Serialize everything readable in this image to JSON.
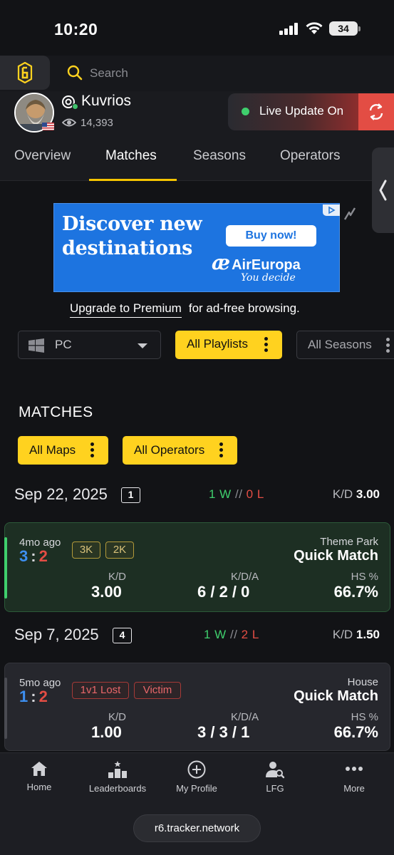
{
  "status_bar": {
    "time": "10:20",
    "battery": "34"
  },
  "header": {
    "search_placeholder": "Search"
  },
  "profile": {
    "username": "Kuvrios",
    "views": "14,393",
    "live_update_label": "Live Update On"
  },
  "tabs": [
    {
      "label": "Overview"
    },
    {
      "label": "Matches"
    },
    {
      "label": "Seasons"
    },
    {
      "label": "Operators"
    }
  ],
  "ad": {
    "headline_line1": "Discover new",
    "headline_line2": "destinations",
    "button": "Buy now!",
    "brand": "AirEuropa",
    "tagline": "You decide"
  },
  "premium": {
    "link": "Upgrade to Premium",
    "text": "for ad-free browsing."
  },
  "filters": {
    "platform": "PC",
    "playlist": "All Playlists",
    "season": "All Seasons"
  },
  "matches": {
    "title": "MATCHES",
    "map_filter": "All Maps",
    "operator_filter": "All Operators",
    "groups": [
      {
        "date": "Sep 22, 2025",
        "count": "1",
        "wins": "1 W",
        "sep": "//",
        "losses": "0 L",
        "kd_label": "K/D",
        "kd": "3.00",
        "matches": [
          {
            "ago": "4mo ago",
            "score_a": "3",
            "score_b": "2",
            "tags": [
              "3K",
              "2K"
            ],
            "map": "Theme Park",
            "mode": "Quick Match",
            "kd_label": "K/D",
            "kd": "3.00",
            "kda_label": "K/D/A",
            "kda": "6 / 2 / 0",
            "hs_label": "HS %",
            "hs": "66.7%",
            "result": "win",
            "accent": "#3fcf6d"
          }
        ]
      },
      {
        "date": "Sep 7, 2025",
        "count": "4",
        "wins": "1 W",
        "sep": "//",
        "losses": "2 L",
        "kd_label": "K/D",
        "kd": "1.50",
        "matches": [
          {
            "ago": "5mo ago",
            "score_a": "1",
            "score_b": "2",
            "tags": [
              "1v1 Lost",
              "Victim"
            ],
            "map": "House",
            "mode": "Quick Match",
            "kd_label": "K/D",
            "kd": "1.00",
            "kda_label": "K/D/A",
            "kda": "3 / 3 / 1",
            "hs_label": "HS %",
            "hs": "66.7%",
            "result": "loss",
            "accent": "#4a4b52"
          }
        ]
      }
    ]
  },
  "bottom_nav": [
    {
      "label": "Home",
      "icon": "home-icon"
    },
    {
      "label": "Leaderboards",
      "icon": "leaderboards-icon"
    },
    {
      "label": "My Profile",
      "icon": "plus-circle-icon"
    },
    {
      "label": "LFG",
      "icon": "lfg-icon"
    },
    {
      "label": "More",
      "icon": "more-icon"
    }
  ],
  "url": "r6.tracker.network",
  "colors": {
    "accent_yellow": "#ffd21f",
    "win_green": "#3fcf6d",
    "loss_red": "#e34d44",
    "blue": "#3d8ff0"
  }
}
